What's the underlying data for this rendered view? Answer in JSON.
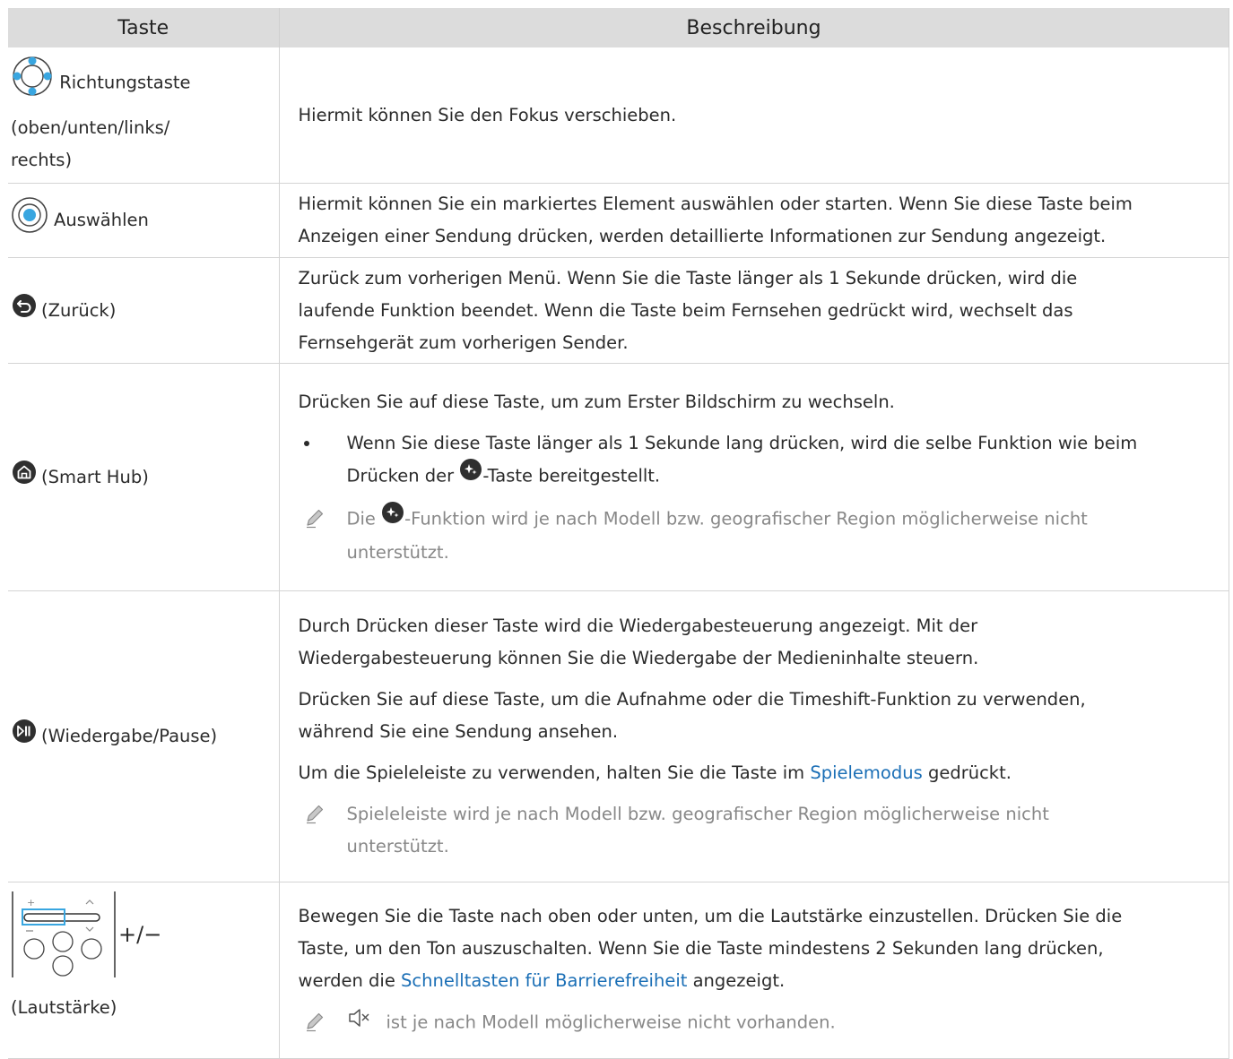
{
  "header": {
    "col_key": "Taste",
    "col_desc": "Beschreibung"
  },
  "rows": [
    {
      "key_line1": "Richtungstaste",
      "key_line2": "(oben/unten/links/",
      "key_line3": "rechts)",
      "icon": "directional-pad-icon",
      "desc": "Hiermit können Sie den Fokus verschieben."
    },
    {
      "key": "Auswählen",
      "icon": "select-button-icon",
      "desc_line1": "Hiermit können Sie ein markiertes Element auswählen oder starten. Wenn Sie diese Taste beim",
      "desc_line2": "Anzeigen einer Sendung drücken, werden detaillierte Informationen zur Sendung angezeigt."
    },
    {
      "key": "(Zurück)",
      "icon": "back-arrow-icon",
      "desc_line1": "Zurück zum vorherigen Menü. Wenn Sie die Taste länger als 1 Sekunde drücken, wird die",
      "desc_line2": "laufende Funktion beendet. Wenn die Taste beim Fernsehen gedrückt wird, wechselt das",
      "desc_line3": "Fernsehgerät zum vorherigen Sender."
    },
    {
      "key": "(Smart Hub)",
      "icon": "home-icon",
      "desc_line1": "Drücken Sie auf diese Taste, um zum Erster Bildschirm zu wechseln.",
      "bullet_line1": "Wenn Sie diese Taste länger als 1 Sekunde lang drücken, wird die selbe Funktion wie beim",
      "bullet_line2_pre": "Drücken der ",
      "bullet_line2_post": "-Taste bereitgestellt.",
      "note_pre": "Die ",
      "note_post": "-Funktion wird je nach Modell bzw. geografischer Region möglicherweise nicht",
      "note_line2": "unterstützt."
    },
    {
      "key": "(Wiedergabe/Pause)",
      "icon": "play-pause-icon",
      "p1_line1": "Durch Drücken dieser Taste wird die Wiedergabesteuerung angezeigt. Mit der",
      "p1_line2": "Wiedergabesteuerung können Sie die Wiedergabe der Medieninhalte steuern.",
      "p2_line1": "Drücken Sie auf diese Taste, um die Aufnahme oder die Timeshift-Funktion zu verwenden,",
      "p2_line2": "während Sie eine Sendung ansehen.",
      "p3_pre": "Um die Spieleleiste zu verwenden, halten Sie die Taste im ",
      "p3_link": "Spielemodus",
      "p3_post": " gedrückt.",
      "note_line1": "Spieleleiste wird je nach Modell bzw. geografischer Region möglicherweise nicht",
      "note_line2": "unterstützt."
    },
    {
      "key_symbol": "+/−",
      "key_label": "(Lautstärke)",
      "icon": "volume-rocker-icon",
      "desc_line1": "Bewegen Sie die Taste nach oben oder unten, um die Lautstärke einzustellen. Drücken Sie die",
      "desc_line2": "Taste, um den Ton auszuschalten. Wenn Sie die Taste mindestens 2 Sekunden lang drücken,",
      "desc_line3_pre": "werden die ",
      "desc_line3_link": "Schnelltasten für Barrierefreiheit",
      "desc_line3_post": " angezeigt.",
      "note_text": "ist je nach Modell möglicherweise nicht vorhanden."
    }
  ]
}
